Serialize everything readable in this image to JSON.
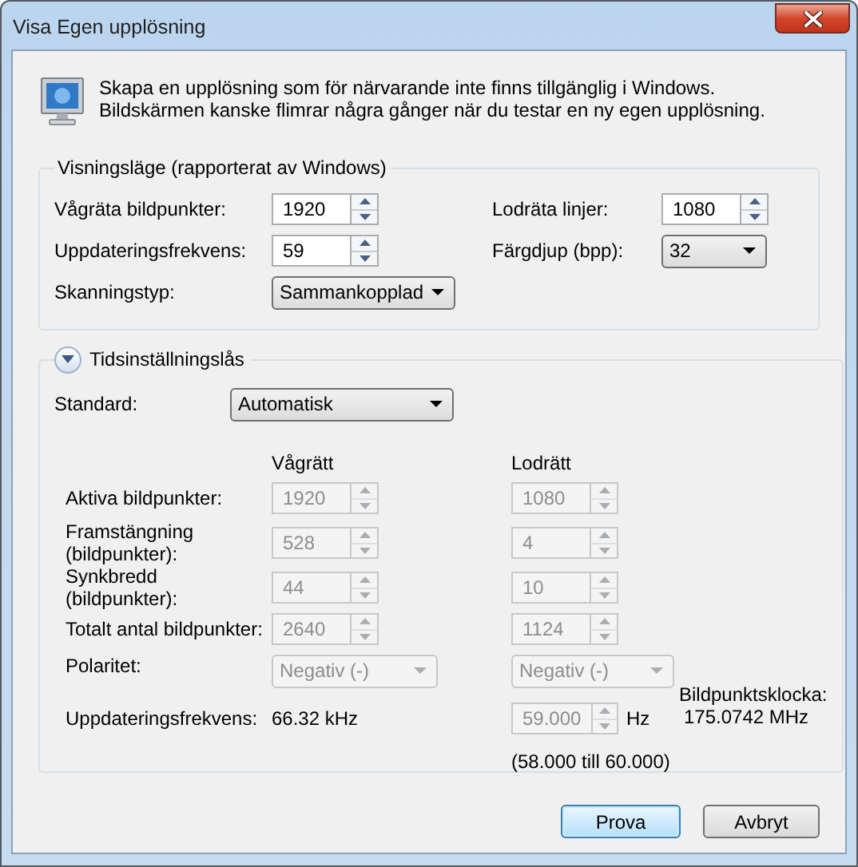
{
  "window": {
    "title": "Visa Egen upplösning"
  },
  "intro": {
    "text": "Skapa en upplösning som för närvarande inte finns tillgänglig i Windows. Bildskärmen kanske flimrar några gånger när du testar en ny egen upplösning."
  },
  "display_mode": {
    "title": "Visningsläge (rapporterat av Windows)",
    "fields": [
      {
        "kind": "spinner",
        "label": "Vågräta bildpunkter:",
        "value": "1920"
      },
      {
        "kind": "spinner",
        "label": "Lodräta linjer:",
        "value": "1080"
      },
      {
        "kind": "spinner",
        "label": "Uppdateringsfrekvens:",
        "value": "59"
      },
      {
        "kind": "dropdown",
        "label": "Färgdjup (bpp):",
        "value": "32"
      },
      {
        "kind": "dropdown",
        "label": "Skanningstyp:",
        "value": "Sammankopplad"
      }
    ]
  },
  "timing": {
    "title": "Tidsinställningslås",
    "expanded": true,
    "standard": {
      "label": "Standard:",
      "value": "Automatisk"
    },
    "columns": [
      "Vågrätt",
      "Lodrätt"
    ],
    "rows": [
      {
        "kind": "spinner",
        "label": "Aktiva bildpunkter:",
        "horizontal": "1920",
        "vertical": "1080",
        "disabled": true
      },
      {
        "kind": "spinner",
        "label": "Framstängning (bildpunkter):",
        "horizontal": "528",
        "vertical": "4",
        "disabled": true
      },
      {
        "kind": "spinner",
        "label": "Synkbredd (bildpunkter):",
        "horizontal": "44",
        "vertical": "10",
        "disabled": true
      },
      {
        "kind": "spinner",
        "label": "Totalt antal bildpunkter:",
        "horizontal": "2640",
        "vertical": "1124",
        "disabled": true
      },
      {
        "kind": "dropdown",
        "label": "Polaritet:",
        "horizontal": "Negativ (-)",
        "vertical": "Negativ (-)",
        "disabled": true
      }
    ],
    "refresh": {
      "label": "Uppdateringsfrekvens:",
      "horizontal": "66.32 kHz",
      "vertical": "59.000",
      "disabled": true,
      "unit": "Hz",
      "range": "(58.000 till 60.000)"
    },
    "pixel_clock": {
      "label": "Bildpunktsklocka:",
      "value": "175.0742 MHz"
    }
  },
  "buttons": [
    {
      "label": "Prova",
      "default": true
    },
    {
      "label": "Avbryt",
      "default": false
    }
  ]
}
